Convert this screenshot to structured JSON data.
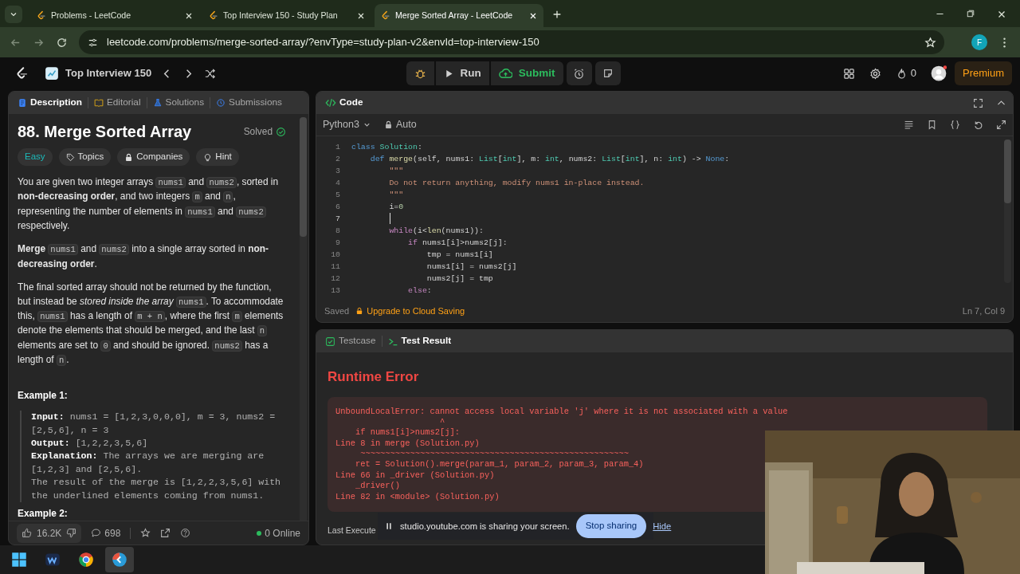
{
  "browser": {
    "tabs": [
      {
        "title": "Problems - LeetCode",
        "selected": false
      },
      {
        "title": "Top Interview 150 - Study Plan",
        "selected": false
      },
      {
        "title": "Merge Sorted Array - LeetCode",
        "selected": true
      }
    ],
    "url": "leetcode.com/problems/merge-sorted-array/?envType=study-plan-v2&envId=top-interview-150",
    "profile_initial": "F"
  },
  "nav": {
    "plan_title": "Top Interview 150",
    "run": "Run",
    "submit": "Submit",
    "streak": "0",
    "premium": "Premium"
  },
  "description_panel": {
    "tabs": [
      {
        "label": "Description",
        "selected": true
      },
      {
        "label": "Editorial",
        "selected": false
      },
      {
        "label": "Solutions",
        "selected": false
      },
      {
        "label": "Submissions",
        "selected": false
      }
    ],
    "title": "88. Merge Sorted Array",
    "status": "Solved",
    "tags": [
      {
        "label": "Easy",
        "kind": "difficulty"
      },
      {
        "label": "Topics",
        "kind": "tag"
      },
      {
        "label": "Companies",
        "kind": "lock"
      },
      {
        "label": "Hint",
        "kind": "hint"
      }
    ],
    "paragraphs": [
      [
        {
          "text": "You are given two integer arrays ",
          "kind": "text"
        },
        {
          "text": "nums1",
          "kind": "code"
        },
        {
          "text": " and ",
          "kind": "text"
        },
        {
          "text": "nums2",
          "kind": "code"
        },
        {
          "text": ", sorted in **non-decreasing order**, and two integers ",
          "kind": "text"
        },
        {
          "text": "m",
          "kind": "code"
        },
        {
          "text": " and ",
          "kind": "text"
        },
        {
          "text": "n",
          "kind": "code"
        },
        {
          "text": ", representing the number of elements in ",
          "kind": "text"
        },
        {
          "text": "nums1",
          "kind": "code"
        },
        {
          "text": " and ",
          "kind": "text"
        },
        {
          "text": "nums2",
          "kind": "code"
        },
        {
          "text": " respectively.",
          "kind": "text"
        }
      ],
      [
        {
          "text": "**Merge** ",
          "kind": "text"
        },
        {
          "text": "nums1",
          "kind": "code"
        },
        {
          "text": " and ",
          "kind": "text"
        },
        {
          "text": "nums2",
          "kind": "code"
        },
        {
          "text": " into a single array sorted in **non-decreasing order**.",
          "kind": "text"
        }
      ],
      [
        {
          "text": "The final sorted array should not be returned by the function, but instead be *stored inside the array* ",
          "kind": "text"
        },
        {
          "text": "nums1",
          "kind": "code"
        },
        {
          "text": ". To accommodate this, ",
          "kind": "text"
        },
        {
          "text": "nums1",
          "kind": "code"
        },
        {
          "text": " has a length of ",
          "kind": "text"
        },
        {
          "text": "m + n",
          "kind": "code"
        },
        {
          "text": ", where the first ",
          "kind": "text"
        },
        {
          "text": "m",
          "kind": "code"
        },
        {
          "text": " elements denote the elements that should be merged, and the last ",
          "kind": "text"
        },
        {
          "text": "n",
          "kind": "code"
        },
        {
          "text": " elements are set to ",
          "kind": "text"
        },
        {
          "text": "0",
          "kind": "code"
        },
        {
          "text": " and should be ignored. ",
          "kind": "text"
        },
        {
          "text": "nums2",
          "kind": "code"
        },
        {
          "text": " has a length of ",
          "kind": "text"
        },
        {
          "text": "n",
          "kind": "code"
        },
        {
          "text": ".",
          "kind": "text"
        }
      ]
    ],
    "examples": [
      {
        "heading": "Example 1:",
        "lines": [
          "**Input:** nums1 = [1,2,3,0,0,0], m = 3, nums2 = [2,5,6], n = 3",
          "**Output:** [1,2,2,3,5,6]",
          "**Explanation:** The arrays we are merging are [1,2,3] and [2,5,6].",
          "The result of the merge is [1,2,2,3,5,6] with the underlined elements coming from nums1."
        ]
      },
      {
        "heading": "Example 2:"
      }
    ],
    "footer": {
      "likes": "16.2K",
      "comments": "698",
      "online": "0 Online"
    }
  },
  "code_panel": {
    "title": "Code",
    "language": "Python3",
    "mode": "Auto",
    "lines": [
      {
        "num": "1",
        "active": false,
        "tokens": [
          {
            "text": "class",
            "kind": "kw"
          },
          {
            "text": " Solution",
            "kind": "cls"
          },
          {
            "text": ":",
            "kind": "p"
          }
        ]
      },
      {
        "num": "2",
        "active": false,
        "tokens": [
          {
            "text": "    def",
            "kind": "kw"
          },
          {
            "text": " merge",
            "kind": "fn"
          },
          {
            "text": "(self, nums1: ",
            "kind": "p"
          },
          {
            "text": "List",
            "kind": "cls"
          },
          {
            "text": "[",
            "kind": "p"
          },
          {
            "text": "int",
            "kind": "cls"
          },
          {
            "text": "], m: ",
            "kind": "p"
          },
          {
            "text": "int",
            "kind": "cls"
          },
          {
            "text": ", nums2: ",
            "kind": "p"
          },
          {
            "text": "List",
            "kind": "cls"
          },
          {
            "text": "[",
            "kind": "p"
          },
          {
            "text": "int",
            "kind": "cls"
          },
          {
            "text": "], n: ",
            "kind": "p"
          },
          {
            "text": "int",
            "kind": "cls"
          },
          {
            "text": ") -> ",
            "kind": "p"
          },
          {
            "text": "None",
            "kind": "kw"
          },
          {
            "text": ":",
            "kind": "p"
          }
        ]
      },
      {
        "num": "3",
        "active": false,
        "tokens": [
          {
            "text": "        \"\"\"",
            "kind": "str"
          }
        ]
      },
      {
        "num": "4",
        "active": false,
        "tokens": [
          {
            "text": "        Do not return anything, modify nums1 in-place instead.",
            "kind": "str"
          }
        ]
      },
      {
        "num": "5",
        "active": false,
        "tokens": [
          {
            "text": "        \"\"\"",
            "kind": "str"
          }
        ]
      },
      {
        "num": "6",
        "active": false,
        "tokens": [
          {
            "text": "        i=",
            "kind": "p"
          },
          {
            "text": "0",
            "kind": "num"
          }
        ]
      },
      {
        "num": "7",
        "active": true
      },
      {
        "num": "8",
        "active": false,
        "tokens": [
          {
            "text": "        while",
            "kind": "ctl"
          },
          {
            "text": "(i<",
            "kind": "p"
          },
          {
            "text": "len",
            "kind": "fn"
          },
          {
            "text": "(nums1)):",
            "kind": "p"
          }
        ]
      },
      {
        "num": "9",
        "active": false,
        "tokens": [
          {
            "text": "            if",
            "kind": "ctl"
          },
          {
            "text": " nums1[i]>nums2[j]:",
            "kind": "p"
          }
        ]
      },
      {
        "num": "10",
        "active": false,
        "tokens": [
          {
            "text": "                tmp = nums1[i]",
            "kind": "p"
          }
        ]
      },
      {
        "num": "11",
        "active": false,
        "tokens": [
          {
            "text": "                nums1[i] = nums2[j]",
            "kind": "p"
          }
        ]
      },
      {
        "num": "12",
        "active": false,
        "tokens": [
          {
            "text": "                nums2[j] = tmp",
            "kind": "p"
          }
        ]
      },
      {
        "num": "13",
        "active": false,
        "tokens": [
          {
            "text": "            else",
            "kind": "ctl"
          },
          {
            "text": ":",
            "kind": "p"
          }
        ]
      }
    ],
    "saved": "Saved",
    "upgrade": "Upgrade to Cloud Saving",
    "position": "Ln 7, Col 9"
  },
  "result_panel": {
    "tabs": [
      {
        "label": "Testcase",
        "selected": false
      },
      {
        "label": "Test Result",
        "selected": true
      }
    ],
    "heading": "Runtime Error",
    "error_lines": [
      "UnboundLocalError: cannot access local variable 'j' where it is not associated with a value",
      "                     ^",
      "    if nums1[i]>nums2[j]:",
      "Line 8 in merge (Solution.py)",
      "     ~~~~~~~~~~~~~~~~~~~~~~~~~~~~~~~~~~~~~~~~~~~~~~~~~~~~~~",
      "    ret = Solution().merge(param_1, param_2, param_3, param_4)",
      "Line 66 in _driver (Solution.py)",
      "    _driver()",
      "Line 82 in <module> (Solution.py)"
    ],
    "last_executed": "Last Execute"
  },
  "share_bar": {
    "message": "studio.youtube.com is sharing your screen.",
    "stop": "Stop sharing",
    "hide": "Hide"
  },
  "taskbar": {
    "apps": [
      {
        "kind": "start",
        "selected": false
      },
      {
        "kind": "meet",
        "selected": false
      },
      {
        "kind": "browser",
        "selected": false
      },
      {
        "kind": "editor",
        "selected": true
      }
    ]
  }
}
